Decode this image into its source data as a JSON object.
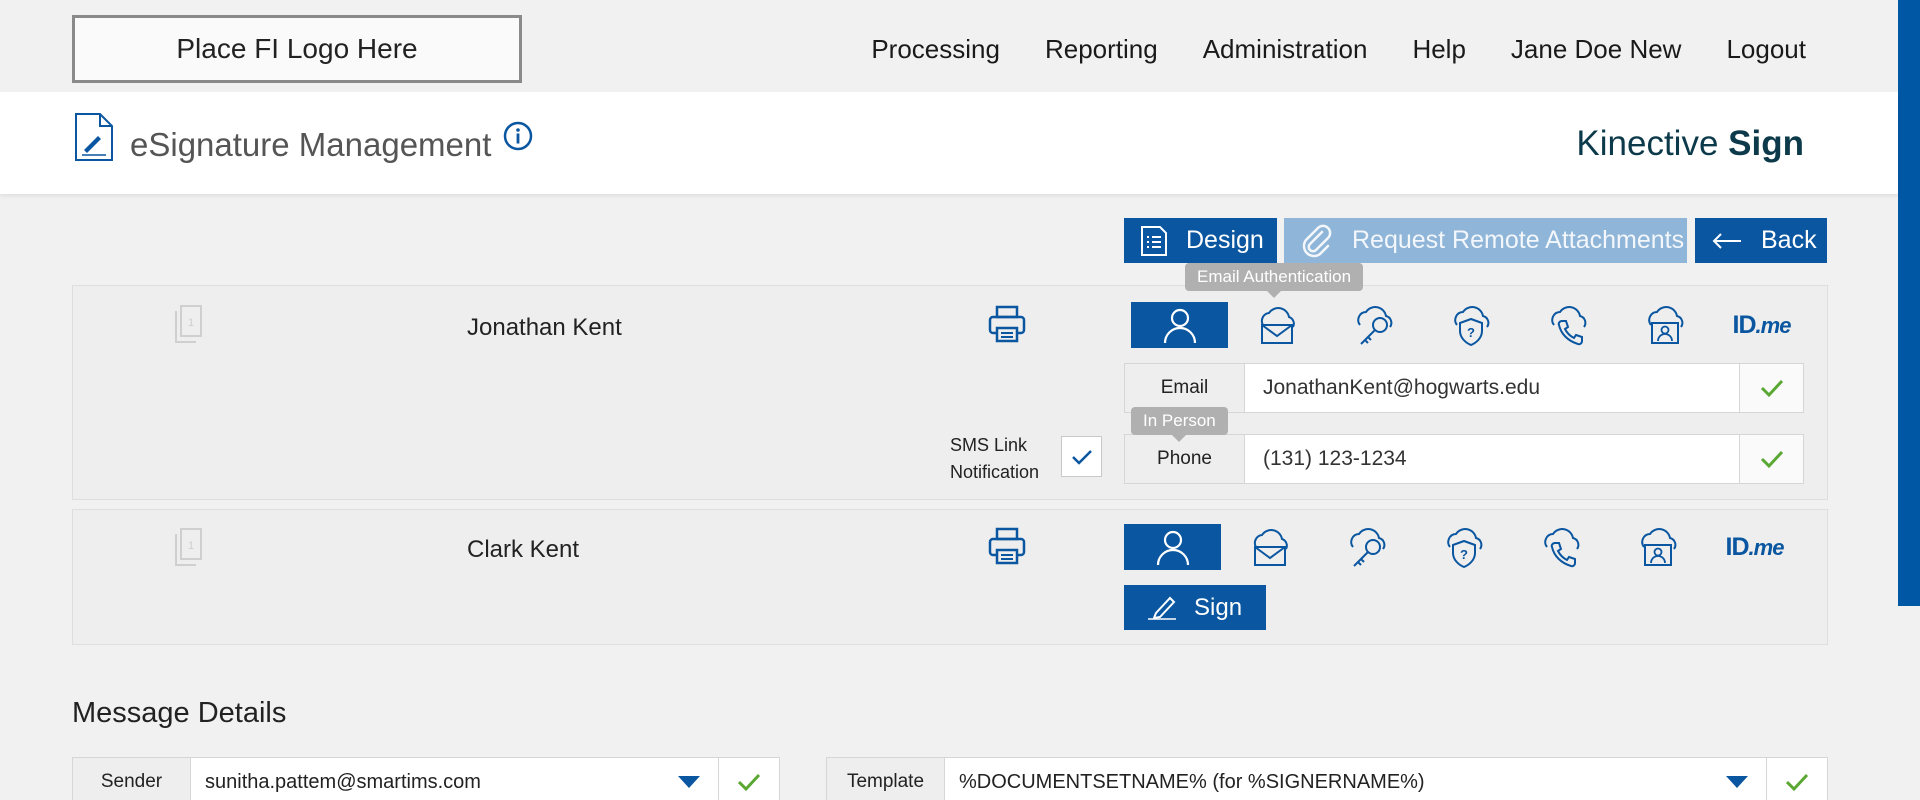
{
  "topbar": {
    "logo_text": "Place FI Logo Here",
    "nav": [
      "Processing",
      "Reporting",
      "Administration",
      "Help",
      "Jane Doe New",
      "Logout"
    ]
  },
  "header": {
    "title": "eSignature Management",
    "brand_prefix": "Kinective",
    "brand_bold": "Sign"
  },
  "actions": {
    "design": "Design",
    "request_remote": "Request Remote Attachments",
    "back": "Back"
  },
  "signers": [
    {
      "page_count": "1",
      "name": "Jonathan Kent",
      "email_label": "Email",
      "email_value": "JonathanKent@hogwarts.edu",
      "phone_label": "Phone",
      "phone_value": "(131) 123-1234",
      "sms_label_line1": "SMS Link",
      "sms_label_line2": "Notification",
      "sms_checked": true
    },
    {
      "page_count": "1",
      "name": "Clark Kent",
      "sign_label": "Sign"
    }
  ],
  "tooltips": {
    "email_auth": "Email Authentication",
    "in_person": "In Person"
  },
  "auth_methods": [
    "in-person",
    "email",
    "key",
    "shield-question",
    "phone-cloud",
    "id-card-cloud",
    "idme"
  ],
  "idme_text": "ID",
  "idme_suffix": ".me",
  "message_details": {
    "title": "Message Details",
    "sender_label": "Sender",
    "sender_value": "sunitha.pattem@smartims.com",
    "template_label": "Template",
    "template_value": "%DOCUMENTSETNAME% (for %SIGNERNAME%)"
  },
  "colors": {
    "primary": "#0a56a0",
    "primary_light": "#8fb5d8",
    "check_green": "#5aa833",
    "brand_text": "#0d3a4a"
  }
}
